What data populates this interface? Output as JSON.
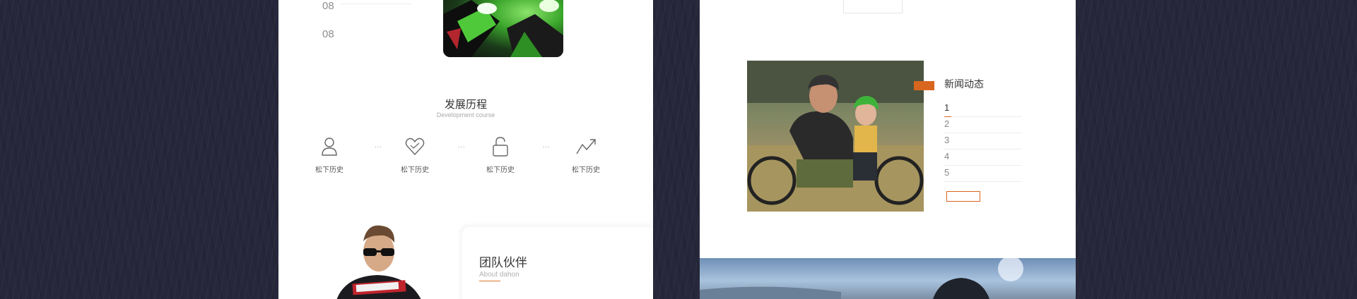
{
  "colors": {
    "accent": "#d9661f",
    "background": "#26273a"
  },
  "left": {
    "news": [
      {
        "day": "08",
        "year_month": "",
        "title": "",
        "desc": ""
      },
      {
        "day": "08",
        "year_month": "",
        "title": "",
        "desc": ""
      }
    ],
    "development": {
      "title": "发展历程",
      "subtitle": "Development course",
      "items": [
        {
          "icon": "person-icon",
          "label": "松下历史",
          "desc": ""
        },
        {
          "icon": "heart-icon",
          "label": "松下历史",
          "desc": ""
        },
        {
          "icon": "lock-icon",
          "label": "松下历史",
          "desc": ""
        },
        {
          "icon": "trend-icon",
          "label": "松下历史",
          "desc": ""
        }
      ],
      "separator": "..."
    },
    "team": {
      "title": "团队伙伴",
      "subtitle": "About dahon",
      "desc": ""
    }
  },
  "right": {
    "news": {
      "subtitle": "",
      "title": "新闻动态",
      "items": [
        {
          "num": "1",
          "text": ""
        },
        {
          "num": "2",
          "text": ""
        },
        {
          "num": "3",
          "text": ""
        },
        {
          "num": "4",
          "text": ""
        },
        {
          "num": "5",
          "text": ""
        }
      ],
      "more_label": ""
    }
  }
}
